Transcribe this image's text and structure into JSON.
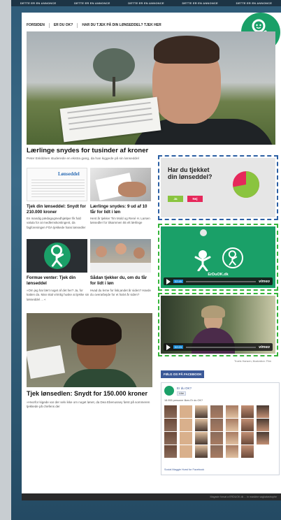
{
  "ad_bar": [
    "DETTE ER EN ANNONCE",
    "DETTE ER EN ANNONCE",
    "DETTE ER EN ANNONCE",
    "DETTE ER EN ANNONCE",
    "DETTE ER EN ANNONCE"
  ],
  "nav": [
    "FORSIDEN",
    "ER DU OK?",
    "HAR DU TJEK PÅ DIN LØNSEDDEL? TJEK HER"
  ],
  "hero": {
    "title": "Lærlinge snydes for tusinder af kroner",
    "summary": "Peter Eskildsen studerede en ekstra gang, da han kiggede på sin lønseddel"
  },
  "articles": [
    {
      "thumb_text": "Lønseddel",
      "title": "Tjek din lønseddel: Snydt for 210.000 kroner",
      "body": "En mandig pædagogmedhjælper fik fuld valuta for at medlemskontingent, da fagforeningen FOA tjekkede hans lønsedler"
    },
    {
      "title": "Lærlinge snydes: 9 ud af 10 får for lidt i løn",
      "body": "Hent år tjekker Tim Mold og René H. Larsen lønsedler for tilsammen 55 elt lærlinge"
    },
    {
      "title": "Formue venter: Tjek din lønseddel",
      "body": "»Om jeg har lært noget af det her? Ja, for katten da. Man skal vrimlig huske at tjekke sin lønseddel ... «"
    },
    {
      "title": "Sådan tjekker du, om du får for lidt i løn",
      "body": "Hvad du lerne for lisk¡andet år siden? Havde du overarbejde for et halvt år siden?"
    }
  ],
  "bottom_article": {
    "title": "Tjek lønsedlen: Snydt for 150.000 kroner",
    "body": "»Hvorfor kigede var der selv ikke om noget lønet, da Dea Ebenussey først på sommeren tjekkede på chefens der"
  },
  "quiz": {
    "question": "Har du tjekket din lønseddel?",
    "yes_label": "Ja",
    "no_label": "Nej",
    "yes_fraction": 0.72,
    "yes_color": "#8ac43f",
    "no_color": "#e6285b"
  },
  "video1": {
    "brand": "ErDuOK.dk",
    "time": "02:45",
    "player": "vimeo"
  },
  "video2": {
    "time": "02:23",
    "player": "vimeo"
  },
  "video_caption": "Troels Hansen, illustration: Film",
  "facebook": {
    "header": "FØLG OS PÅ FACEBOOK",
    "page_name": "Er du OK?",
    "like_label": "Like",
    "count_text": "18.955 personer likes Er du OK?",
    "plugin_text": "Social Maggie Hurst for Facebook"
  },
  "footer": "Magasin forsat a ERDUOK.dk ... in maskine sagkatastrophe",
  "colors": {
    "brand_green": "#1aa068",
    "accent_blue": "#2b5fa3",
    "accent_green": "#35b53a"
  }
}
